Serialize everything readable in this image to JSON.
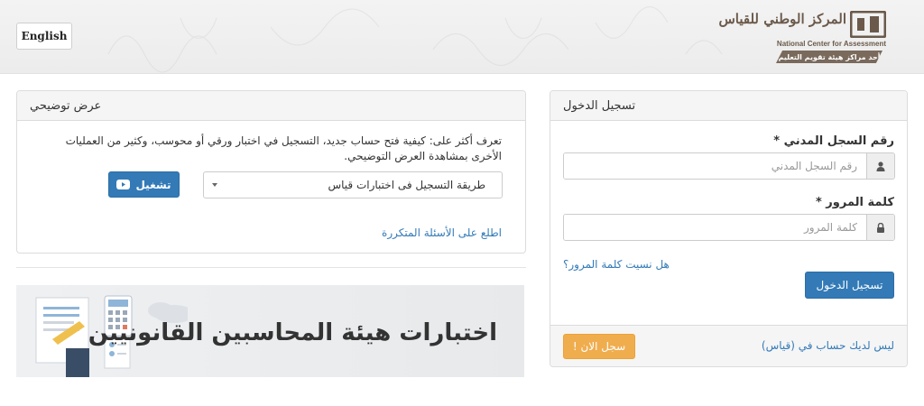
{
  "header": {
    "language_button": "English",
    "logo": {
      "arabic_name": "المركز الوطني للقياس",
      "english_name": "National Center for Assessment",
      "tagline": "أحد مراكز هيئة تقويم التعليم"
    }
  },
  "login": {
    "title": "تسجيل الدخول",
    "national_id_label": "رقم السجل المدني *",
    "national_id_placeholder": "رقم السجل المدني",
    "password_label": "كلمة المرور *",
    "password_placeholder": "كلمة المرور",
    "forgot_password": "هل نسيت كلمة المرور؟",
    "submit_button": "تسجيل الدخول",
    "no_account_text": "ليس لديك حساب في (قياس)",
    "register_button": "سجل الان !"
  },
  "demo": {
    "title": "عرض توضيحي",
    "description": "تعرف أكثر على: كيفية فتح حساب جديد، التسجيل في اختبار ورقي أو محوسب، وكثير من العمليات الأخرى بمشاهدة العرض التوضيحي.",
    "selected_option": "طريقة التسجيل فى اختبارات قياس",
    "play_button": "تشغيل",
    "faq_link": "اطلع على الأسئلة المتكررة"
  },
  "banner": {
    "text": "اختبارات هيئة المحاسبين القانونيين"
  },
  "colors": {
    "primary": "#337ab7",
    "warning": "#f0ad4e",
    "logo_brown": "#6b5a4b"
  }
}
